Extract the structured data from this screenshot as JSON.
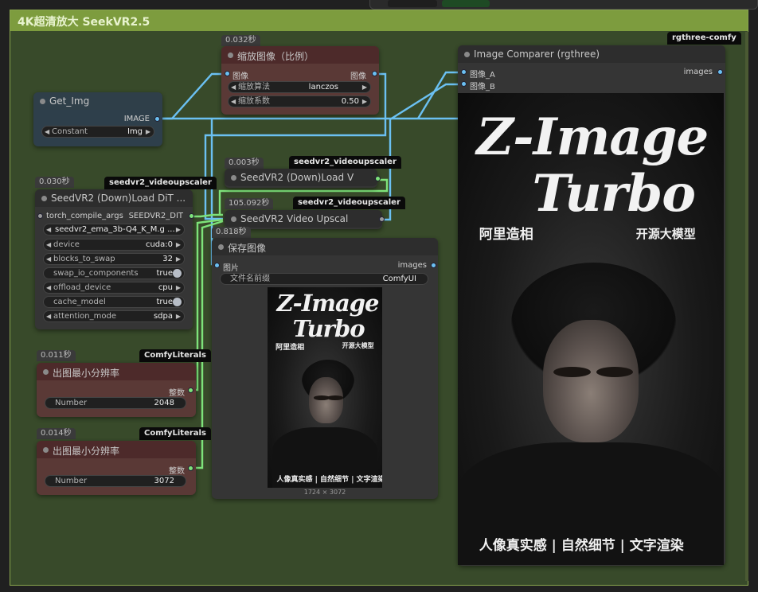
{
  "group": {
    "title": "4K超清放大 SeekVR2.5"
  },
  "nodes": {
    "get_img": {
      "title": "Get_Img",
      "output": "IMAGE",
      "widget_label": "Constant",
      "widget_value": "Img"
    },
    "scale": {
      "time": "0.032秒",
      "title": "缩放图像（比例）",
      "in": "图像",
      "out": "图像",
      "w1_label": "缩放算法",
      "w1_value": "lanczos",
      "w2_label": "缩放系数",
      "w2_value": "0.50"
    },
    "vae_loader": {
      "time": "0.003秒",
      "tag": "seedvr2_videoupscaler",
      "title": "SeedVR2 (Down)Load V"
    },
    "dit_loader": {
      "time": "0.030秒",
      "tag": "seedvr2_videoupscaler",
      "title": "SeedVR2 (Down)Load DiT ...",
      "in": "torch_compile_args",
      "out": "SEEDVR2_DIT",
      "widgets": [
        {
          "label": "",
          "value": "seedvr2_ema_3b-Q4_K_M.g ...",
          "type": "combo"
        },
        {
          "label": "device",
          "value": "cuda:0",
          "type": "combo"
        },
        {
          "label": "blocks_to_swap",
          "value": "32",
          "type": "combo"
        },
        {
          "label": "swap_io_components",
          "value": "true",
          "type": "toggle"
        },
        {
          "label": "offload_device",
          "value": "cpu",
          "type": "combo"
        },
        {
          "label": "cache_model",
          "value": "true",
          "type": "toggle"
        },
        {
          "label": "attention_mode",
          "value": "sdpa",
          "type": "combo"
        }
      ]
    },
    "upscale": {
      "time": "105.092秒",
      "tag": "seedvr2_videoupscaler",
      "title": "SeedVR2 Video Upscal"
    },
    "save": {
      "time": "0.818秒",
      "title": "保存图像",
      "in": "图片",
      "out": "images",
      "widget_label": "文件名前缀",
      "widget_value": "ComfyUI",
      "dims": "1724 × 3072"
    },
    "min_res": {
      "time": "0.011秒",
      "tag": "ComfyLiterals",
      "title": "出图最小分辨率",
      "out": "整数",
      "widget_label": "Number",
      "widget_value": "2048"
    },
    "max_res": {
      "time": "0.014秒",
      "tag": "ComfyLiterals",
      "title": "出图最小分辨率",
      "out": "整数",
      "widget_label": "Number",
      "widget_value": "3072"
    },
    "comparer": {
      "tag": "rgthree-comfy",
      "title": "Image Comparer (rgthree)",
      "in_a": "图像_A",
      "in_b": "图像_B",
      "out": "images"
    }
  },
  "poster": {
    "line1": "Z-Image",
    "line2": "Turbo",
    "left_cn": "阿里造相",
    "right_cn": "开源大模型",
    "bottom": "人像真实感 | 自然细节 | 文字渲染"
  },
  "colors": {
    "group_header": "#7d9c3e",
    "group_bg": "#384a2a",
    "wire_image": "#6bc0f2",
    "wire_int": "#7ee37a"
  }
}
